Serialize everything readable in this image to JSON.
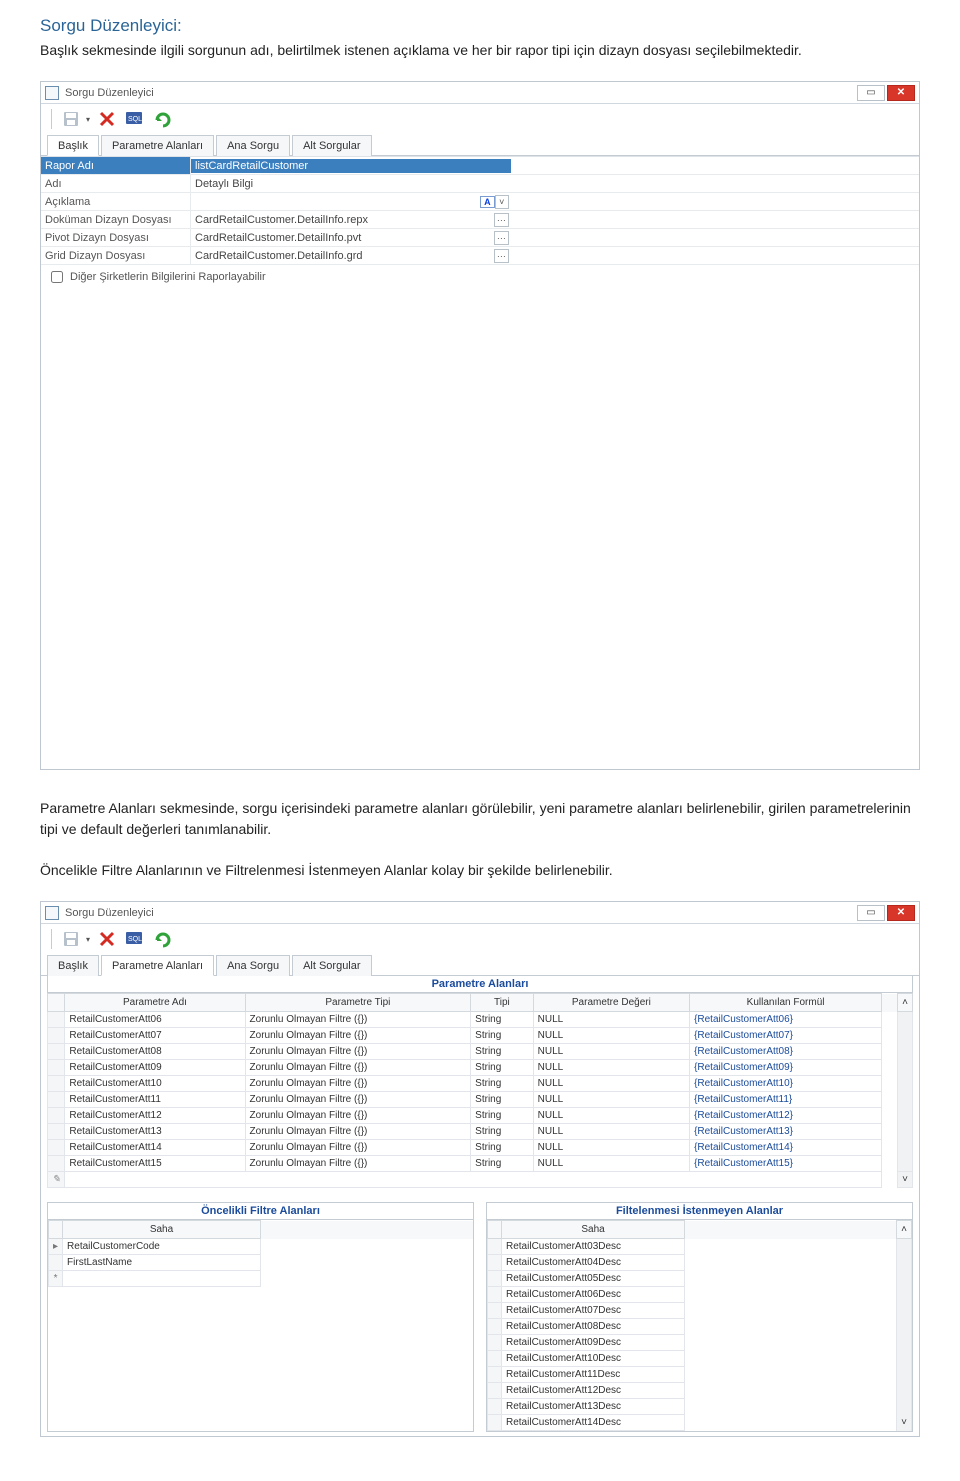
{
  "doc": {
    "heading": "Sorgu Düzenleyici:",
    "p1": "Başlık sekmesinde ilgili sorgunun adı, belirtilmek istenen açıklama ve her bir rapor tipi için dizayn dosyası seçilebilmektedir.",
    "p2": "Parametre Alanları sekmesinde, sorgu içerisindeki parametre alanları görülebilir, yeni parametre alanları belirlenebilir, girilen parametrelerinin tipi ve default değerleri tanımlanabilir.",
    "p3": "Öncelikle Filtre Alanlarının ve Filtrelenmesi İstenmeyen Alanlar kolay bir şekilde belirlenebilir."
  },
  "window_title": "Sorgu Düzenleyici",
  "tabs": {
    "t0": "Başlık",
    "t1": "Parametre Alanları",
    "t2": "Ana Sorgu",
    "t3": "Alt Sorgular"
  },
  "form": {
    "l0": "Rapor Adı",
    "v0": "listCardRetailCustomer",
    "l1": "Adı",
    "v1": "Detaylı Bilgi",
    "l2": "Açıklama",
    "v2": "",
    "l3": "Doküman Dizayn Dosyası",
    "v3": "CardRetailCustomer.DetailInfo.repx",
    "l4": "Pivot Dizayn Dosyası",
    "v4": "CardRetailCustomer.DetailInfo.pvt",
    "l5": "Grid Dizayn Dosyası",
    "v5": "CardRetailCustomer.DetailInfo.grd",
    "check": "Diğer Şirketlerin Bilgilerini Raporlayabilir"
  },
  "params": {
    "header": "Parametre Alanları",
    "cols": {
      "c0": "Parametre Adı",
      "c1": "Parametre Tipi",
      "c2": "Tipi",
      "c3": "Parametre Değeri",
      "c4": "Kullanılan Formül"
    },
    "ptype": "Zorunlu Olmayan Filtre ({})",
    "tipi": "String",
    "deger": "NULL",
    "rows": [
      {
        "n": "RetailCustomerAtt06",
        "f": "{RetailCustomerAtt06}"
      },
      {
        "n": "RetailCustomerAtt07",
        "f": "{RetailCustomerAtt07}"
      },
      {
        "n": "RetailCustomerAtt08",
        "f": "{RetailCustomerAtt08}"
      },
      {
        "n": "RetailCustomerAtt09",
        "f": "{RetailCustomerAtt09}"
      },
      {
        "n": "RetailCustomerAtt10",
        "f": "{RetailCustomerAtt10}"
      },
      {
        "n": "RetailCustomerAtt11",
        "f": "{RetailCustomerAtt11}"
      },
      {
        "n": "RetailCustomerAtt12",
        "f": "{RetailCustomerAtt12}"
      },
      {
        "n": "RetailCustomerAtt13",
        "f": "{RetailCustomerAtt13}"
      },
      {
        "n": "RetailCustomerAtt14",
        "f": "{RetailCustomerAtt14}"
      },
      {
        "n": "RetailCustomerAtt15",
        "f": "{RetailCustomerAtt15}"
      }
    ]
  },
  "prio": {
    "header": "Öncelikli Filtre Alanları",
    "col": "Saha",
    "rows": [
      "RetailCustomerCode",
      "FirstLastName"
    ]
  },
  "excl": {
    "header": "Filtelenmesi İstenmeyen Alanlar",
    "col": "Saha",
    "rows": [
      "RetailCustomerAtt03Desc",
      "RetailCustomerAtt04Desc",
      "RetailCustomerAtt05Desc",
      "RetailCustomerAtt06Desc",
      "RetailCustomerAtt07Desc",
      "RetailCustomerAtt08Desc",
      "RetailCustomerAtt09Desc",
      "RetailCustomerAtt10Desc",
      "RetailCustomerAtt11Desc",
      "RetailCustomerAtt12Desc",
      "RetailCustomerAtt13Desc",
      "RetailCustomerAtt14Desc"
    ]
  }
}
